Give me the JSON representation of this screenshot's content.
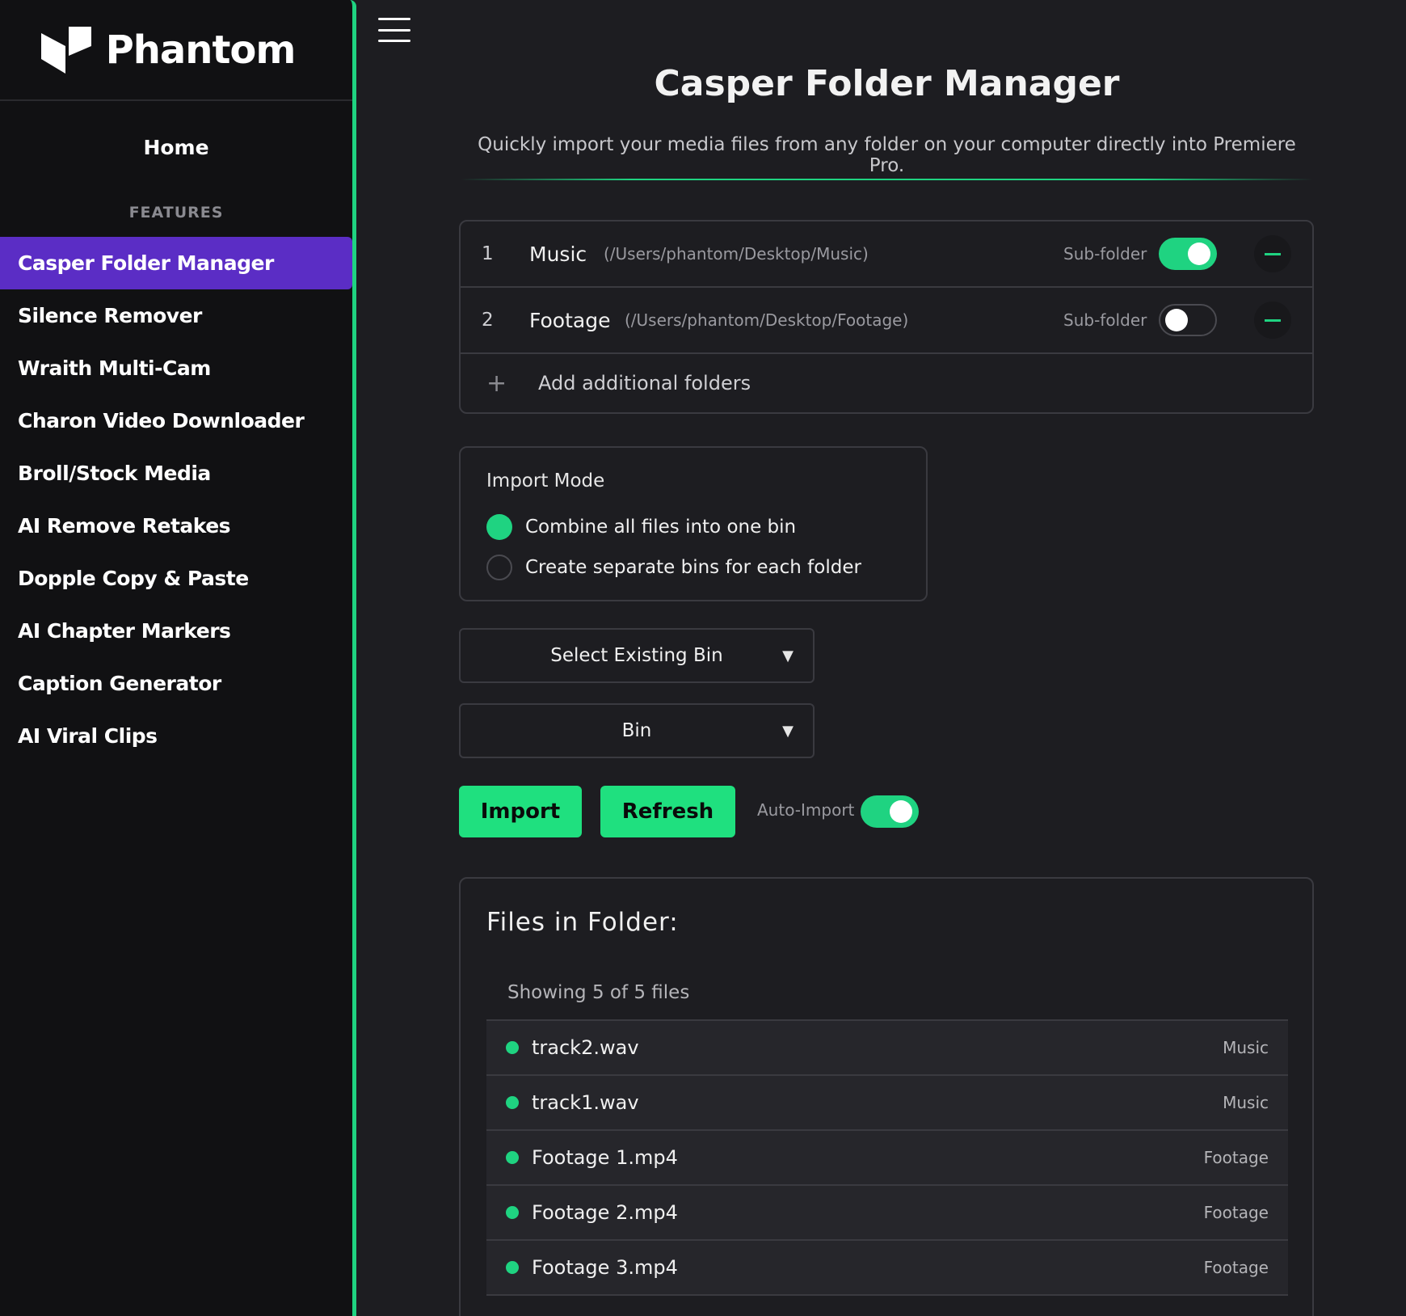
{
  "brand": {
    "name": "Phantom"
  },
  "sidebar": {
    "home": "Home",
    "section_label": "FEATURES",
    "items": [
      {
        "label": "Casper Folder Manager",
        "active": true
      },
      {
        "label": "Silence Remover"
      },
      {
        "label": "Wraith Multi-Cam"
      },
      {
        "label": "Charon Video Downloader"
      },
      {
        "label": "Broll/Stock Media"
      },
      {
        "label": "AI Remove Retakes"
      },
      {
        "label": "Dopple Copy & Paste"
      },
      {
        "label": "AI Chapter Markers"
      },
      {
        "label": "Caption Generator"
      },
      {
        "label": "AI Viral Clips"
      }
    ]
  },
  "header": {
    "menu_icon": "hamburger-icon",
    "title": "Casper Folder Manager",
    "subtitle": "Quickly import your media files from any folder on your computer directly into Premiere Pro."
  },
  "folders": [
    {
      "index": "1",
      "name": "Music",
      "path": "(/Users/phantom/Desktop/Music)",
      "subfolder_label": "Sub-folder",
      "subfolder_on": true
    },
    {
      "index": "2",
      "name": "Footage",
      "path": "(/Users/phantom/Desktop/Footage)",
      "subfolder_label": "Sub-folder",
      "subfolder_on": false
    }
  ],
  "add_folder": {
    "icon": "+",
    "label": "Add additional folders"
  },
  "import_mode": {
    "title": "Import Mode",
    "options": [
      {
        "label": "Combine all files into one bin",
        "selected": true
      },
      {
        "label": "Create separate bins for each folder",
        "selected": false
      }
    ]
  },
  "selects": {
    "existing_bin": "Select Existing Bin",
    "bin": "Bin",
    "arrow": "▼"
  },
  "actions": {
    "import": "Import",
    "refresh": "Refresh",
    "auto_import_label": "Auto-Import",
    "auto_import_on": true
  },
  "files": {
    "title": "Files in Folder:",
    "count": "Showing 5 of 5 files",
    "items": [
      {
        "name": "track2.wav",
        "folder": "Music"
      },
      {
        "name": "track1.wav",
        "folder": "Music"
      },
      {
        "name": "Footage 1.mp4",
        "folder": "Footage"
      },
      {
        "name": "Footage 2.mp4",
        "folder": "Footage"
      },
      {
        "name": "Footage 3.mp4",
        "folder": "Footage"
      }
    ]
  },
  "colors": {
    "accent": "#1fd381",
    "active_nav": "#5b2dc5",
    "background": "#1d1d21",
    "sidebar": "#111113"
  }
}
